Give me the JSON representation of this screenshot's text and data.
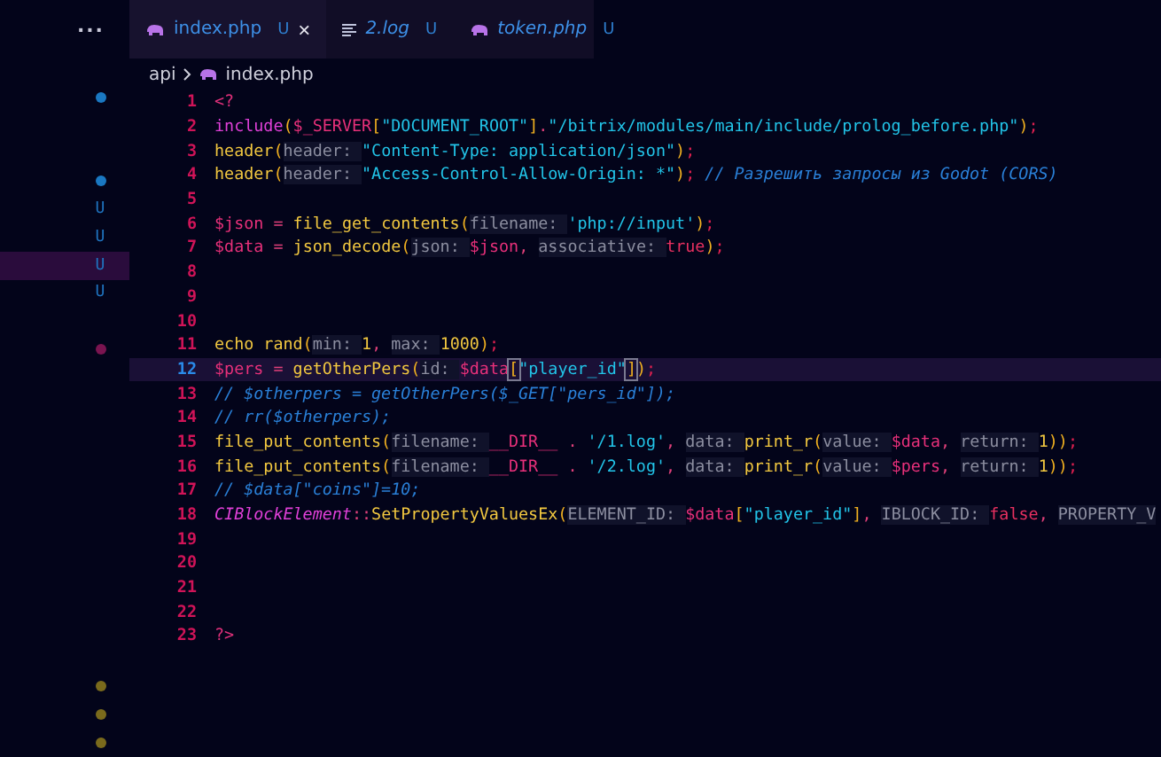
{
  "sidebar": {
    "more": "...",
    "rows": [
      {
        "kind": "dot",
        "color": "#1a78c2",
        "selected": false
      },
      {
        "kind": "blank",
        "selected": false
      },
      {
        "kind": "blank",
        "selected": false
      },
      {
        "kind": "dot",
        "color": "#1a78c2",
        "selected": false
      },
      {
        "kind": "letter",
        "text": "U",
        "selected": false
      },
      {
        "kind": "letter",
        "text": "U",
        "selected": false
      },
      {
        "kind": "letter",
        "text": "U",
        "selected": true
      },
      {
        "kind": "letter",
        "text": "U",
        "selected": false
      },
      {
        "kind": "blank",
        "selected": false
      },
      {
        "kind": "dot",
        "color": "#7a1450",
        "selected": false
      },
      {
        "kind": "blank",
        "selected": false
      },
      {
        "kind": "blank",
        "selected": false
      },
      {
        "kind": "blank",
        "selected": false
      },
      {
        "kind": "blank",
        "selected": false
      },
      {
        "kind": "blank",
        "selected": false
      },
      {
        "kind": "blank",
        "selected": false
      },
      {
        "kind": "blank",
        "selected": false
      },
      {
        "kind": "blank",
        "selected": false
      },
      {
        "kind": "blank",
        "selected": false
      },
      {
        "kind": "blank",
        "selected": false
      },
      {
        "kind": "blank",
        "selected": false
      },
      {
        "kind": "dot",
        "color": "#7a6a1c",
        "selected": false
      },
      {
        "kind": "dot",
        "color": "#7a6a1c",
        "selected": false
      },
      {
        "kind": "dot",
        "color": "#7a6a1c",
        "selected": false
      }
    ]
  },
  "tabs": [
    {
      "label": "index.php",
      "status": "U",
      "kind": "php",
      "selected": true,
      "close": "×"
    },
    {
      "label": "2.log",
      "status": "U",
      "kind": "log",
      "selected": false
    },
    {
      "label": "token.php",
      "status": "U",
      "kind": "php",
      "selected": false
    }
  ],
  "breadcrumb": {
    "folder": "api",
    "file": "index.php"
  },
  "lines": [
    {
      "number": "1",
      "current": false,
      "tokens": [
        {
          "kind": "tag",
          "text": "<?"
        }
      ]
    },
    {
      "number": "2",
      "current": false,
      "tokens": [
        {
          "kind": "kw",
          "text": "include"
        },
        {
          "kind": "punct",
          "text": "("
        },
        {
          "kind": "var",
          "text": "$_SERVER"
        },
        {
          "kind": "punct",
          "text": "["
        },
        {
          "kind": "str",
          "text": "\"DOCUMENT_ROOT\""
        },
        {
          "kind": "punct",
          "text": "]"
        },
        {
          "kind": "op",
          "text": "."
        },
        {
          "kind": "str",
          "text": "\"/bitrix/modules/main/include/prolog_before.php\""
        },
        {
          "kind": "punct",
          "text": ")"
        },
        {
          "kind": "semi",
          "text": ";"
        }
      ]
    },
    {
      "number": "3",
      "current": false,
      "tokens": [
        {
          "kind": "fn",
          "text": "header"
        },
        {
          "kind": "punct",
          "text": "("
        },
        {
          "kind": "hint",
          "text": "header: "
        },
        {
          "kind": "str",
          "text": "\"Content-Type: application/json\""
        },
        {
          "kind": "punct",
          "text": ")"
        },
        {
          "kind": "semi",
          "text": ";"
        }
      ]
    },
    {
      "number": "4",
      "current": false,
      "tokens": [
        {
          "kind": "fn",
          "text": "header"
        },
        {
          "kind": "punct",
          "text": "("
        },
        {
          "kind": "hint",
          "text": "header: "
        },
        {
          "kind": "str",
          "text": "\"Access-Control-Allow-Origin: *\""
        },
        {
          "kind": "punct",
          "text": ")"
        },
        {
          "kind": "semi",
          "text": "; "
        },
        {
          "kind": "comment",
          "text": "// Разрешить запросы из Godot (CORS)"
        }
      ]
    },
    {
      "number": "5",
      "current": false
    },
    {
      "number": "6",
      "current": false,
      "tokens": [
        {
          "kind": "var",
          "text": "$json"
        },
        {
          "kind": "op",
          "text": " = "
        },
        {
          "kind": "fn",
          "text": "file_get_contents"
        },
        {
          "kind": "punct",
          "text": "("
        },
        {
          "kind": "hint",
          "text": "filename: "
        },
        {
          "kind": "str",
          "text": "'php://input'"
        },
        {
          "kind": "punct",
          "text": ")"
        },
        {
          "kind": "semi",
          "text": ";"
        }
      ]
    },
    {
      "number": "7",
      "current": false,
      "tokens": [
        {
          "kind": "var",
          "text": "$data"
        },
        {
          "kind": "op",
          "text": " = "
        },
        {
          "kind": "fn",
          "text": "json_decode"
        },
        {
          "kind": "punct",
          "text": "("
        },
        {
          "kind": "hint",
          "text": "json: "
        },
        {
          "kind": "var",
          "text": "$json"
        },
        {
          "kind": "op",
          "text": ", "
        },
        {
          "kind": "hint",
          "text": "associative: "
        },
        {
          "kind": "bool",
          "text": "true"
        },
        {
          "kind": "punct",
          "text": ")"
        },
        {
          "kind": "semi",
          "text": ";"
        }
      ]
    },
    {
      "number": "8",
      "current": false
    },
    {
      "number": "9",
      "current": false
    },
    {
      "number": "10",
      "current": false
    },
    {
      "number": "11",
      "current": false,
      "tokens": [
        {
          "kind": "fn",
          "text": "echo rand"
        },
        {
          "kind": "punct",
          "text": "("
        },
        {
          "kind": "hint",
          "text": "min: "
        },
        {
          "kind": "num",
          "text": "1"
        },
        {
          "kind": "op",
          "text": ", "
        },
        {
          "kind": "hint",
          "text": "max: "
        },
        {
          "kind": "num",
          "text": "1000"
        },
        {
          "kind": "punct",
          "text": ")"
        },
        {
          "kind": "semi",
          "text": ";"
        }
      ]
    },
    {
      "number": "12",
      "current": true,
      "tokens": [
        {
          "kind": "var",
          "text": "$pers"
        },
        {
          "kind": "op",
          "text": " = "
        },
        {
          "kind": "fn",
          "text": "getOtherPers"
        },
        {
          "kind": "punct",
          "text": "("
        },
        {
          "kind": "hint",
          "text": "id: "
        },
        {
          "kind": "var",
          "text": "$data"
        },
        {
          "kind": "match",
          "text": "["
        },
        {
          "kind": "str",
          "text": "\"player_id\""
        },
        {
          "kind": "match",
          "text": "]"
        },
        {
          "kind": "punct",
          "text": ")"
        },
        {
          "kind": "semi",
          "text": ";"
        }
      ]
    },
    {
      "number": "13",
      "current": false,
      "tokens": [
        {
          "kind": "comment",
          "text": "// $otherpers = getOtherPers($_GET[\"pers_id\"]);"
        }
      ]
    },
    {
      "number": "14",
      "current": false,
      "tokens": [
        {
          "kind": "comment",
          "text": "// rr($otherpers);"
        }
      ]
    },
    {
      "number": "15",
      "current": false,
      "tokens": [
        {
          "kind": "fn",
          "text": "file_put_contents"
        },
        {
          "kind": "punct",
          "text": "("
        },
        {
          "kind": "hint",
          "text": "filename: "
        },
        {
          "kind": "var",
          "text": "__DIR__"
        },
        {
          "kind": "op",
          "text": " . "
        },
        {
          "kind": "str",
          "text": "'/1.log'"
        },
        {
          "kind": "op",
          "text": ", "
        },
        {
          "kind": "hint",
          "text": "data: "
        },
        {
          "kind": "fn",
          "text": "print_r"
        },
        {
          "kind": "punct",
          "text": "("
        },
        {
          "kind": "hint",
          "text": "value: "
        },
        {
          "kind": "var",
          "text": "$data"
        },
        {
          "kind": "op",
          "text": ", "
        },
        {
          "kind": "hint",
          "text": "return: "
        },
        {
          "kind": "num",
          "text": "1"
        },
        {
          "kind": "punct",
          "text": "))"
        },
        {
          "kind": "semi",
          "text": ";"
        }
      ]
    },
    {
      "number": "16",
      "current": false,
      "tokens": [
        {
          "kind": "fn",
          "text": "file_put_contents"
        },
        {
          "kind": "punct",
          "text": "("
        },
        {
          "kind": "hint",
          "text": "filename: "
        },
        {
          "kind": "var",
          "text": "__DIR__"
        },
        {
          "kind": "op",
          "text": " . "
        },
        {
          "kind": "str",
          "text": "'/2.log'"
        },
        {
          "kind": "op",
          "text": ", "
        },
        {
          "kind": "hint",
          "text": "data: "
        },
        {
          "kind": "fn",
          "text": "print_r"
        },
        {
          "kind": "punct",
          "text": "("
        },
        {
          "kind": "hint",
          "text": "value: "
        },
        {
          "kind": "var",
          "text": "$pers"
        },
        {
          "kind": "op",
          "text": ", "
        },
        {
          "kind": "hint",
          "text": "return: "
        },
        {
          "kind": "num",
          "text": "1"
        },
        {
          "kind": "punct",
          "text": "))"
        },
        {
          "kind": "semi",
          "text": ";"
        }
      ]
    },
    {
      "number": "17",
      "current": false,
      "tokens": [
        {
          "kind": "comment",
          "text": "// $data[\"coins\"]=10;"
        }
      ]
    },
    {
      "number": "18",
      "current": false,
      "tokens": [
        {
          "kind": "cls",
          "text": "CIBlockElement"
        },
        {
          "kind": "op",
          "text": "::"
        },
        {
          "kind": "fn",
          "text": "SetPropertyValuesEx"
        },
        {
          "kind": "punct",
          "text": "("
        },
        {
          "kind": "hint",
          "text": "ELEMENT_ID: "
        },
        {
          "kind": "var",
          "text": "$data"
        },
        {
          "kind": "punct",
          "text": "["
        },
        {
          "kind": "str",
          "text": "\"player_id\""
        },
        {
          "kind": "punct",
          "text": "]"
        },
        {
          "kind": "op",
          "text": ", "
        },
        {
          "kind": "hint",
          "text": "IBLOCK_ID: "
        },
        {
          "kind": "bool",
          "text": "false"
        },
        {
          "kind": "op",
          "text": ", "
        },
        {
          "kind": "hint",
          "text": "PROPERTY_V"
        }
      ]
    },
    {
      "number": "19",
      "current": false
    },
    {
      "number": "20",
      "current": false
    },
    {
      "number": "21",
      "current": false
    },
    {
      "number": "22",
      "current": false
    },
    {
      "number": "23",
      "current": false,
      "tokens": [
        {
          "kind": "tag",
          "text": "?>"
        }
      ]
    }
  ]
}
